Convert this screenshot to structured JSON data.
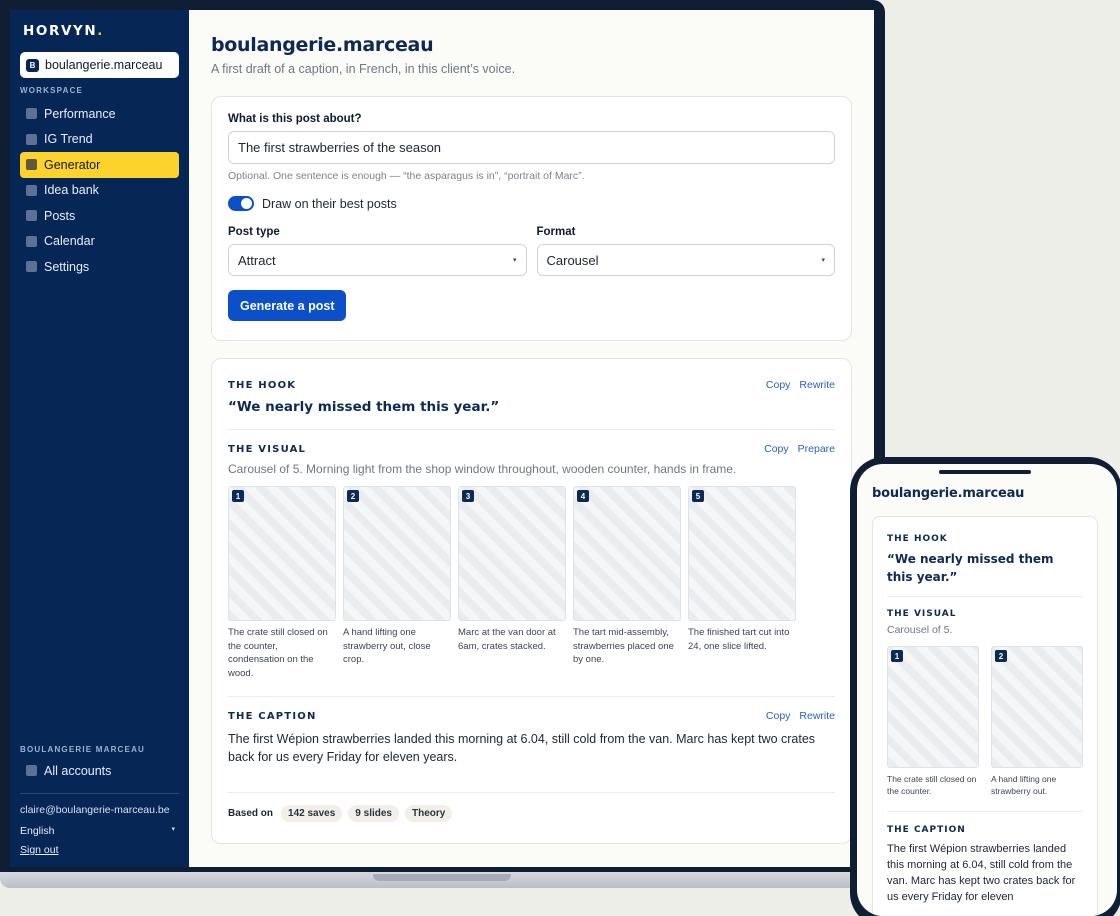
{
  "brand": {
    "name": "HORVYN",
    "dot": "."
  },
  "account": {
    "badge": "B",
    "handle": "boulangerie.marceau"
  },
  "sidebar": {
    "workspace_label": "WORKSPACE",
    "items": [
      {
        "label": "Performance",
        "icon": "square-icon",
        "active": false
      },
      {
        "label": "IG Trend",
        "icon": "square-icon",
        "active": false
      },
      {
        "label": "Generator",
        "icon": "square-icon",
        "active": true
      },
      {
        "label": "Idea bank",
        "icon": "square-icon",
        "active": false
      },
      {
        "label": "Posts",
        "icon": "square-icon",
        "active": false
      },
      {
        "label": "Calendar",
        "icon": "square-icon",
        "active": false
      },
      {
        "label": "Settings",
        "icon": "square-icon",
        "active": false
      }
    ],
    "group_label": "BOULANGERIE MARCEAU",
    "all_accounts": "All accounts",
    "email": "claire@boulangerie-marceau.be",
    "language": "English",
    "language_caret": "▾",
    "sign_out": "Sign out"
  },
  "main": {
    "title": "boulangerie.marceau",
    "subtitle": "A first draft of a caption, in French, in this client’s voice."
  },
  "form": {
    "about_label": "What is this post about?",
    "about_value": "The first strawberries of the season",
    "about_hint": "Optional. One sentence is enough — “the asparagus is in”, “portrait of Marc”.",
    "toggle_label": "Draw on their best posts",
    "toggle_on": true,
    "post_type_label": "Post type",
    "post_type_value": "Attract",
    "format_label": "Format",
    "format_value": "Carousel",
    "select_caret": "▾",
    "generate_button": "Generate a post"
  },
  "result": {
    "hook": {
      "title": "THE HOOK",
      "copy": "Copy",
      "rewrite": "Rewrite",
      "text": "“We nearly missed them this year.”"
    },
    "visual": {
      "title": "THE VISUAL",
      "copy": "Copy",
      "prepare": "Prepare",
      "description": "Carousel of 5. Morning light from the shop window throughout, wooden counter, hands in frame.",
      "slides": [
        {
          "num": "1",
          "caption": "The crate still closed on the counter, condensation on the wood."
        },
        {
          "num": "2",
          "caption": "A hand lifting one strawberry out, close crop."
        },
        {
          "num": "3",
          "caption": "Marc at the van door at 6am, crates stacked."
        },
        {
          "num": "4",
          "caption": "The tart mid-assembly, strawberries placed one by one."
        },
        {
          "num": "5",
          "caption": "The finished tart cut into 24, one slice lifted."
        }
      ]
    },
    "caption": {
      "title": "THE CAPTION",
      "copy": "Copy",
      "rewrite": "Rewrite",
      "text": "The first Wépion strawberries landed this morning at 6.04, still cold from the van. Marc has kept two crates back for us every Friday for eleven years."
    },
    "based_on": {
      "label": "Based on",
      "chips": [
        "142 saves",
        "9 slides",
        "Theory"
      ]
    }
  },
  "phone": {
    "title": "boulangerie.marceau",
    "hook_title": "THE HOOK",
    "hook_text": "“We nearly missed them this year.”",
    "visual_title": "THE VISUAL",
    "visual_desc": "Carousel of 5.",
    "slides": [
      {
        "num": "1",
        "caption": "The crate still closed on the counter."
      },
      {
        "num": "2",
        "caption": "A hand lifting one strawberry out."
      }
    ],
    "caption_title": "THE CAPTION",
    "caption_text": "The first Wépion strawberries landed this morning at 6.04, still cold from the van. Marc has kept two crates back for us every Friday for eleven"
  }
}
